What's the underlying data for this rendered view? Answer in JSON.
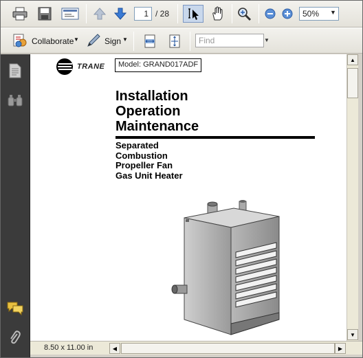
{
  "toolbar": {
    "page_current": "1",
    "page_total": "/ 28",
    "zoom": "50%",
    "collaborate_label": "Collaborate",
    "sign_label": "Sign",
    "find_placeholder": "Find"
  },
  "document": {
    "brand": "TRANE",
    "model": "Model: GRAND017ADF",
    "title_lines": [
      "Installation",
      "Operation",
      "Maintenance"
    ],
    "subtitle_lines": [
      "Separated",
      "Combustion",
      "Propeller Fan",
      "Gas Unit Heater"
    ]
  },
  "status": {
    "page_size": "8.50 x 11.00 in"
  },
  "icons": [
    "print-icon",
    "save-icon",
    "email-icon",
    "prev-page-icon",
    "next-page-icon",
    "select-tool-icon",
    "hand-tool-icon",
    "marquee-zoom-icon",
    "zoom-out-icon",
    "zoom-in-icon",
    "collaborate-icon",
    "sign-icon",
    "fit-width-icon",
    "fit-page-icon",
    "pages-panel-icon",
    "find-panel-icon",
    "comments-panel-icon",
    "attachments-panel-icon"
  ]
}
